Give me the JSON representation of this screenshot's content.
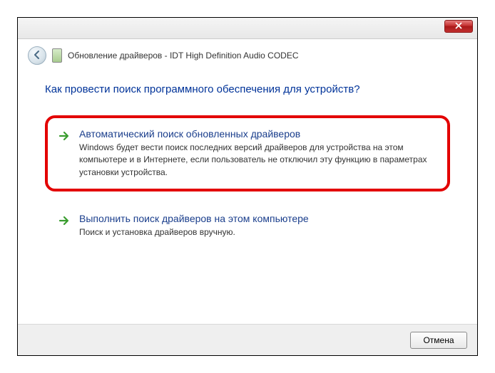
{
  "window": {
    "title": "Обновление драйверов - IDT High Definition Audio CODEC"
  },
  "heading": "Как провести поиск программного обеспечения для устройств?",
  "options": [
    {
      "title": "Автоматический поиск обновленных драйверов",
      "description": "Windows будет вести поиск последних версий драйверов для устройства на этом компьютере и в Интернете, если пользователь не отключил эту функцию в параметрах установки устройства."
    },
    {
      "title": "Выполнить поиск драйверов на этом компьютере",
      "description": "Поиск и установка драйверов вручную."
    }
  ],
  "footer": {
    "cancel": "Отмена"
  }
}
